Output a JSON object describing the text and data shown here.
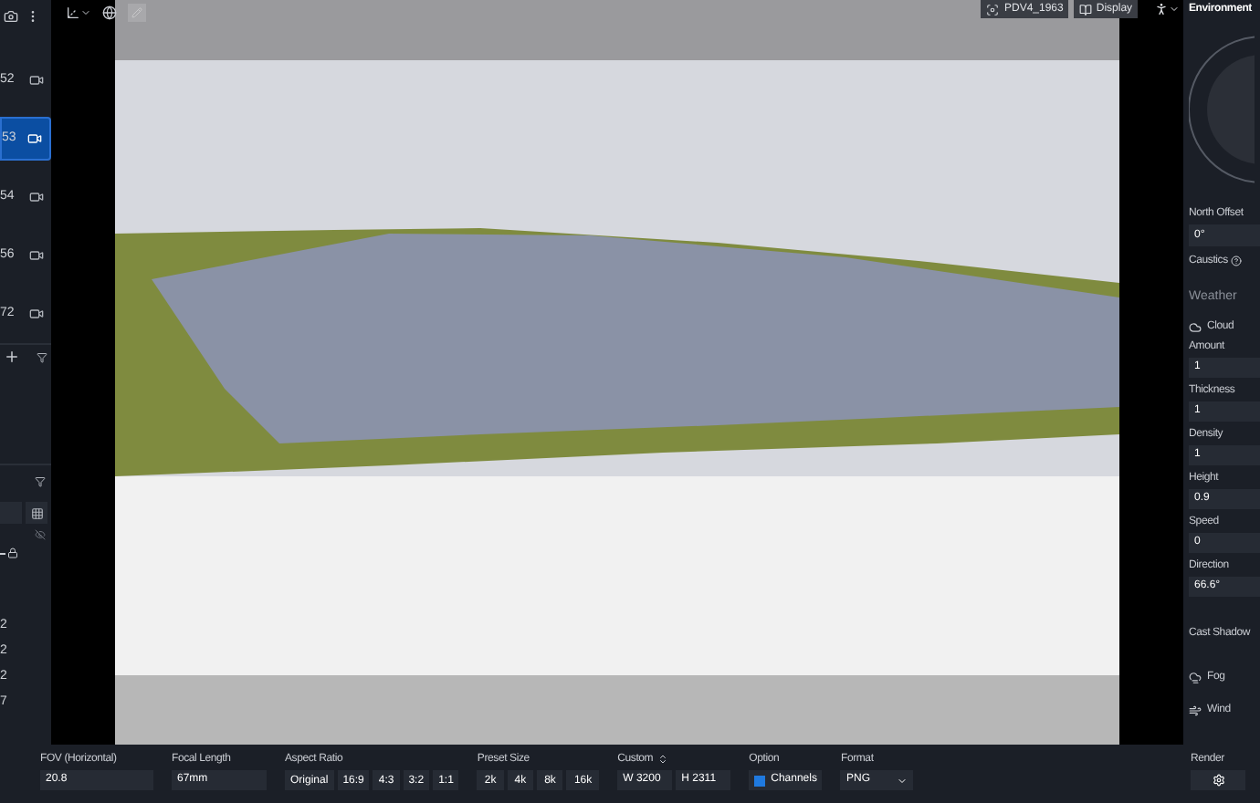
{
  "sidebar": {
    "cameras": [
      {
        "label": "52",
        "selected": false
      },
      {
        "label": "53",
        "selected": true
      },
      {
        "label": "54",
        "selected": false
      },
      {
        "label": "56",
        "selected": false
      },
      {
        "label": "72",
        "selected": false
      }
    ],
    "values": [
      "2",
      "2",
      "2",
      "7"
    ]
  },
  "toolbar": {
    "camera_name": "PDV4_1963",
    "display": "Display"
  },
  "environment": {
    "title": "Environment",
    "north_offset": {
      "label": "North Offset",
      "value": "0°"
    },
    "caustics": "Caustics",
    "weather": {
      "title": "Weather",
      "cloud": "Cloud",
      "fields": [
        {
          "label": "Amount",
          "value": "1"
        },
        {
          "label": "Thickness",
          "value": "1"
        },
        {
          "label": "Density",
          "value": "1"
        },
        {
          "label": "Height",
          "value": "0.9"
        },
        {
          "label": "Speed",
          "value": "0"
        },
        {
          "label": "Direction",
          "value": "66.6°"
        }
      ]
    },
    "cast_shadow": "Cast Shadow",
    "fog": "Fog",
    "wind": "Wind"
  },
  "bottom_bar": {
    "fov": {
      "label": "FOV (Horizontal)",
      "value": "20.8"
    },
    "focal_length": {
      "label": "Focal Length",
      "value": "67mm"
    },
    "aspect_ratio": {
      "label": "Aspect Ratio",
      "options": [
        "Original",
        "16:9",
        "4:3",
        "3:2",
        "1:1"
      ]
    },
    "preset_size": {
      "label": "Preset Size",
      "options": [
        "2k",
        "4k",
        "8k",
        "16k"
      ]
    },
    "custom": {
      "label": "Custom",
      "width": "W 3200",
      "height": "H 2311"
    },
    "option": {
      "label": "Option",
      "channels": "Channels",
      "checked": true
    },
    "format": {
      "label": "Format",
      "value": "PNG"
    },
    "render": {
      "label": "Render"
    }
  }
}
